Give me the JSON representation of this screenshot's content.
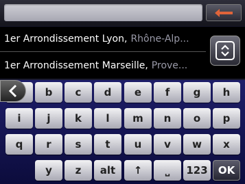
{
  "search": {
    "value": ""
  },
  "results": [
    {
      "name": "1er Arrondissement Lyon,",
      "region": "Rhône-Alp..."
    },
    {
      "name": "1er Arrondissement Marseille,",
      "region": "Prove..."
    }
  ],
  "keyboard": {
    "row1": [
      "a",
      "b",
      "c",
      "d",
      "e",
      "f",
      "g",
      "h"
    ],
    "row2": [
      "i",
      "j",
      "k",
      "l",
      "m",
      "n",
      "o",
      "p"
    ],
    "row3": [
      "q",
      "r",
      "s",
      "t",
      "u",
      "v",
      "w",
      "x"
    ],
    "row4": [
      "y",
      "z",
      "alt",
      "↑",
      "⎵",
      "123",
      "OK"
    ]
  },
  "icons": {
    "backspace": "backspace-arrow-icon",
    "scroll": "chevron-up-down-icon",
    "back": "chevron-left-icon"
  },
  "colors": {
    "accent": "#e0643a",
    "keyboard_bg": "#1a1a5c"
  }
}
